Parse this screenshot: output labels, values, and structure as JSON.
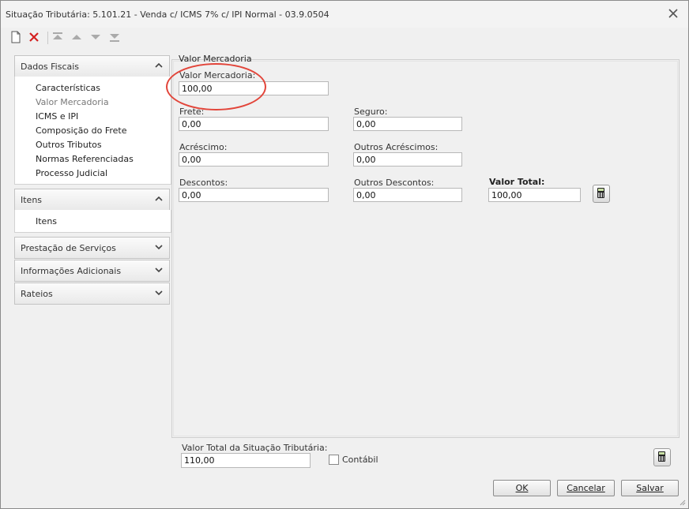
{
  "window": {
    "title": "Situação Tributária: 5.101.21 - Venda c/ ICMS 7% c/ IPI Normal - 03.9.0504"
  },
  "toolbar": {
    "icons": [
      "new-document-icon",
      "delete-icon",
      "move-first-icon",
      "move-up-icon",
      "move-down-icon",
      "move-last-icon"
    ]
  },
  "sidebar": {
    "sections": [
      {
        "label": "Dados Fiscais",
        "expanded": true,
        "items": [
          "Características",
          "Valor Mercadoria",
          "ICMS e IPI",
          "Composição do Frete",
          "Outros Tributos",
          "Normas Referenciadas",
          "Processo Judicial"
        ]
      },
      {
        "label": "Itens",
        "expanded": true,
        "items": [
          "Itens"
        ]
      },
      {
        "label": "Prestação de Serviços",
        "expanded": false
      },
      {
        "label": "Informações Adicionais",
        "expanded": false
      },
      {
        "label": "Rateios",
        "expanded": false
      }
    ]
  },
  "main": {
    "section_title": "Valor Mercadoria",
    "fields": {
      "valor_mercadoria": {
        "label": "Valor Mercadoria:",
        "value": "100,00"
      },
      "frete": {
        "label": "Frete:",
        "value": "0,00"
      },
      "seguro": {
        "label": "Seguro:",
        "value": "0,00"
      },
      "acrescimo": {
        "label": "Acréscimo:",
        "value": "0,00"
      },
      "outros_acrescimos": {
        "label": "Outros Acréscimos:",
        "value": "0,00"
      },
      "descontos": {
        "label": "Descontos:",
        "value": "0,00"
      },
      "outros_descontos": {
        "label": "Outros Descontos:",
        "value": "0,00"
      },
      "valor_total": {
        "label": "Valor Total:",
        "value": "100,00"
      }
    }
  },
  "footer": {
    "total_label": "Valor Total da Situação Tributária:",
    "total_value": "110,00",
    "contabil_label": "Contábil",
    "contabil_checked": false,
    "buttons": {
      "ok": "OK",
      "cancel": "Cancelar",
      "save": "Salvar"
    }
  },
  "colors": {
    "highlight": "#e2453a",
    "delete": "#d42020"
  }
}
